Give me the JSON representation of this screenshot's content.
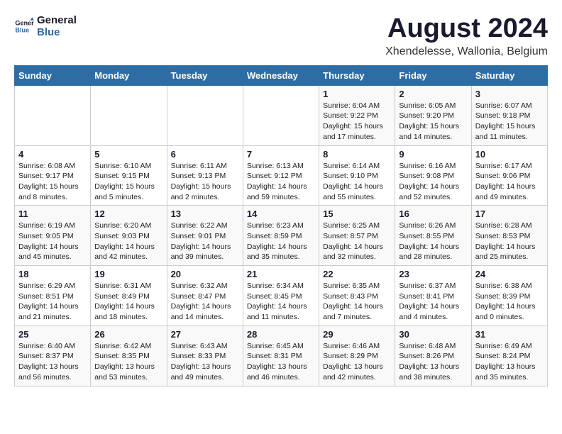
{
  "logo": {
    "line1": "General",
    "line2": "Blue"
  },
  "title": "August 2024",
  "subtitle": "Xhendelesse, Wallonia, Belgium",
  "headers": [
    "Sunday",
    "Monday",
    "Tuesday",
    "Wednesday",
    "Thursday",
    "Friday",
    "Saturday"
  ],
  "weeks": [
    [
      {
        "day": "",
        "info": ""
      },
      {
        "day": "",
        "info": ""
      },
      {
        "day": "",
        "info": ""
      },
      {
        "day": "",
        "info": ""
      },
      {
        "day": "1",
        "info": "Sunrise: 6:04 AM\nSunset: 9:22 PM\nDaylight: 15 hours and 17 minutes."
      },
      {
        "day": "2",
        "info": "Sunrise: 6:05 AM\nSunset: 9:20 PM\nDaylight: 15 hours and 14 minutes."
      },
      {
        "day": "3",
        "info": "Sunrise: 6:07 AM\nSunset: 9:18 PM\nDaylight: 15 hours and 11 minutes."
      }
    ],
    [
      {
        "day": "4",
        "info": "Sunrise: 6:08 AM\nSunset: 9:17 PM\nDaylight: 15 hours and 8 minutes."
      },
      {
        "day": "5",
        "info": "Sunrise: 6:10 AM\nSunset: 9:15 PM\nDaylight: 15 hours and 5 minutes."
      },
      {
        "day": "6",
        "info": "Sunrise: 6:11 AM\nSunset: 9:13 PM\nDaylight: 15 hours and 2 minutes."
      },
      {
        "day": "7",
        "info": "Sunrise: 6:13 AM\nSunset: 9:12 PM\nDaylight: 14 hours and 59 minutes."
      },
      {
        "day": "8",
        "info": "Sunrise: 6:14 AM\nSunset: 9:10 PM\nDaylight: 14 hours and 55 minutes."
      },
      {
        "day": "9",
        "info": "Sunrise: 6:16 AM\nSunset: 9:08 PM\nDaylight: 14 hours and 52 minutes."
      },
      {
        "day": "10",
        "info": "Sunrise: 6:17 AM\nSunset: 9:06 PM\nDaylight: 14 hours and 49 minutes."
      }
    ],
    [
      {
        "day": "11",
        "info": "Sunrise: 6:19 AM\nSunset: 9:05 PM\nDaylight: 14 hours and 45 minutes."
      },
      {
        "day": "12",
        "info": "Sunrise: 6:20 AM\nSunset: 9:03 PM\nDaylight: 14 hours and 42 minutes."
      },
      {
        "day": "13",
        "info": "Sunrise: 6:22 AM\nSunset: 9:01 PM\nDaylight: 14 hours and 39 minutes."
      },
      {
        "day": "14",
        "info": "Sunrise: 6:23 AM\nSunset: 8:59 PM\nDaylight: 14 hours and 35 minutes."
      },
      {
        "day": "15",
        "info": "Sunrise: 6:25 AM\nSunset: 8:57 PM\nDaylight: 14 hours and 32 minutes."
      },
      {
        "day": "16",
        "info": "Sunrise: 6:26 AM\nSunset: 8:55 PM\nDaylight: 14 hours and 28 minutes."
      },
      {
        "day": "17",
        "info": "Sunrise: 6:28 AM\nSunset: 8:53 PM\nDaylight: 14 hours and 25 minutes."
      }
    ],
    [
      {
        "day": "18",
        "info": "Sunrise: 6:29 AM\nSunset: 8:51 PM\nDaylight: 14 hours and 21 minutes."
      },
      {
        "day": "19",
        "info": "Sunrise: 6:31 AM\nSunset: 8:49 PM\nDaylight: 14 hours and 18 minutes."
      },
      {
        "day": "20",
        "info": "Sunrise: 6:32 AM\nSunset: 8:47 PM\nDaylight: 14 hours and 14 minutes."
      },
      {
        "day": "21",
        "info": "Sunrise: 6:34 AM\nSunset: 8:45 PM\nDaylight: 14 hours and 11 minutes."
      },
      {
        "day": "22",
        "info": "Sunrise: 6:35 AM\nSunset: 8:43 PM\nDaylight: 14 hours and 7 minutes."
      },
      {
        "day": "23",
        "info": "Sunrise: 6:37 AM\nSunset: 8:41 PM\nDaylight: 14 hours and 4 minutes."
      },
      {
        "day": "24",
        "info": "Sunrise: 6:38 AM\nSunset: 8:39 PM\nDaylight: 14 hours and 0 minutes."
      }
    ],
    [
      {
        "day": "25",
        "info": "Sunrise: 6:40 AM\nSunset: 8:37 PM\nDaylight: 13 hours and 56 minutes."
      },
      {
        "day": "26",
        "info": "Sunrise: 6:42 AM\nSunset: 8:35 PM\nDaylight: 13 hours and 53 minutes."
      },
      {
        "day": "27",
        "info": "Sunrise: 6:43 AM\nSunset: 8:33 PM\nDaylight: 13 hours and 49 minutes."
      },
      {
        "day": "28",
        "info": "Sunrise: 6:45 AM\nSunset: 8:31 PM\nDaylight: 13 hours and 46 minutes."
      },
      {
        "day": "29",
        "info": "Sunrise: 6:46 AM\nSunset: 8:29 PM\nDaylight: 13 hours and 42 minutes."
      },
      {
        "day": "30",
        "info": "Sunrise: 6:48 AM\nSunset: 8:26 PM\nDaylight: 13 hours and 38 minutes."
      },
      {
        "day": "31",
        "info": "Sunrise: 6:49 AM\nSunset: 8:24 PM\nDaylight: 13 hours and 35 minutes."
      }
    ]
  ]
}
